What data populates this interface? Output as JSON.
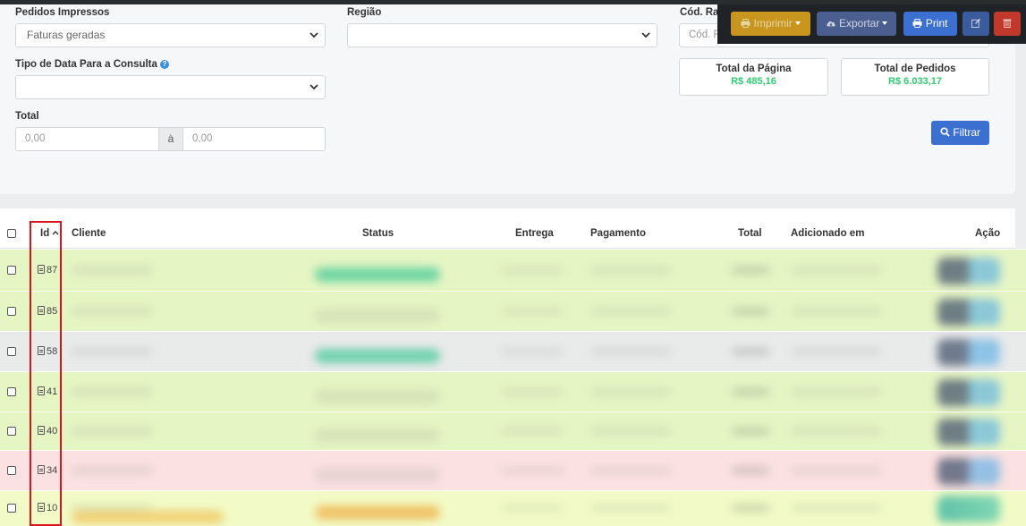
{
  "filters": {
    "pedidos_impressos": {
      "label": "Pedidos Impressos",
      "value": "Faturas geradas"
    },
    "regiao": {
      "label": "Região",
      "value": ""
    },
    "cod_rastreio": {
      "label": "Cód. Ras",
      "placeholder": "Cód. R"
    },
    "tipo_data": {
      "label": "Tipo de Data Para a Consulta",
      "help": "?",
      "value": ""
    },
    "total": {
      "label": "Total",
      "from_placeholder": "0,00",
      "separator": "à",
      "to_placeholder": "0,00"
    },
    "filter_button": "Filtrar"
  },
  "totals": {
    "page": {
      "label": "Total da Página",
      "value": "R$ 485,16"
    },
    "orders": {
      "label": "Total de Pedidos",
      "value": "R$ 6.033,17"
    }
  },
  "toolbar": {
    "imprimir": "Imprimir",
    "exportar": "Exportar",
    "print": "Print"
  },
  "table": {
    "columns": {
      "id": "Id",
      "cliente": "Cliente",
      "status": "Status",
      "entrega": "Entrega",
      "pagamento": "Pagamento",
      "total": "Total",
      "adicionado": "Adicionado em",
      "acao": "Ação"
    },
    "rows": [
      {
        "id": "87",
        "bg": "#e6f5c4"
      },
      {
        "id": "85",
        "bg": "#e6f5c4"
      },
      {
        "id": "58",
        "bg": "#e9eaea"
      },
      {
        "id": "41",
        "bg": "#e6f5c4"
      },
      {
        "id": "40",
        "bg": "#e6f5c4"
      },
      {
        "id": "34",
        "bg": "#fbe1e1"
      },
      {
        "id": "10",
        "bg": "#f2fbc7"
      }
    ]
  },
  "colors": {
    "green_value": "#2ecc71",
    "btn_imprimir": "#c8961f",
    "btn_exportar": "#4a5f8f",
    "btn_print": "#3b6fd0",
    "btn_edit": "#3a5c9c",
    "btn_delete": "#c0392b",
    "btn_filtrar": "#3b6fd0",
    "highlight": "#d9141c"
  }
}
